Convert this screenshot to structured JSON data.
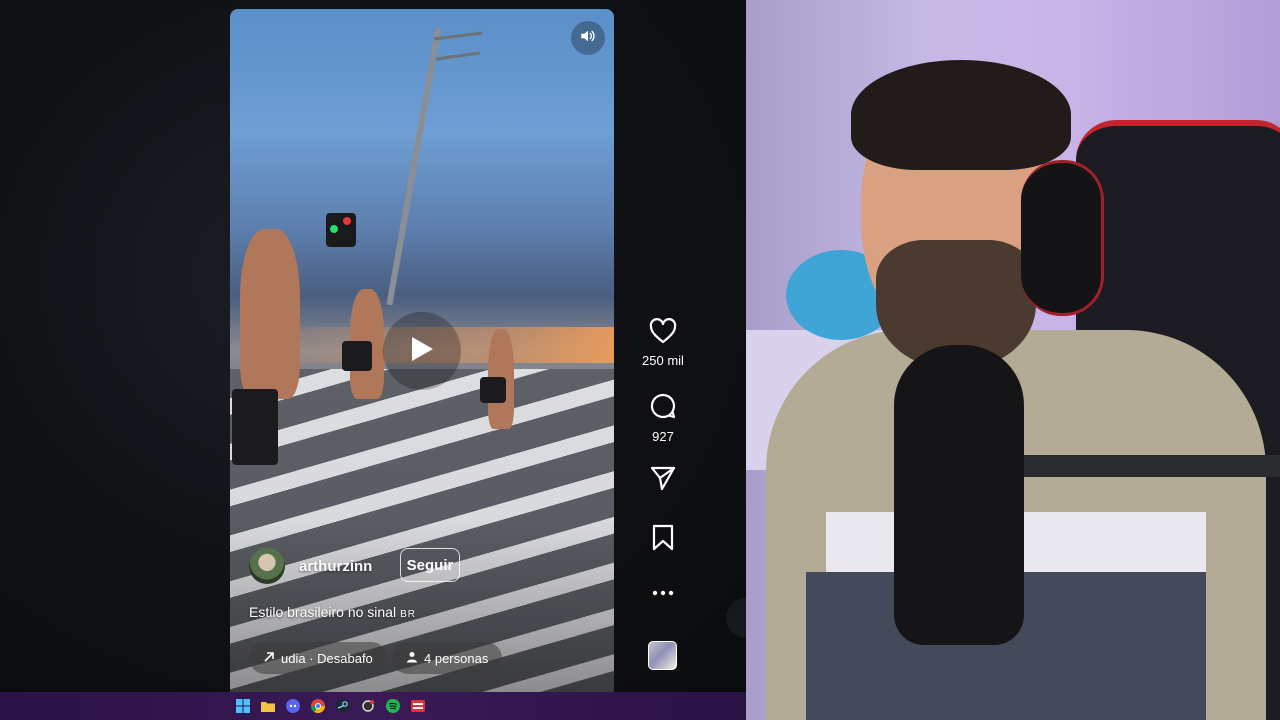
{
  "post": {
    "author": "arthurzinn",
    "follow_label": "Seguir",
    "caption": "Estilo brasileiro no sinal",
    "caption_flag": "BR",
    "audio_chip": "udia · Desabafo",
    "people_chip": "4 personas"
  },
  "actions": {
    "likes": "250 mil",
    "comments": "927"
  },
  "icons": {
    "mute": "speaker-icon",
    "play": "play-icon",
    "like": "heart-icon",
    "comment": "comment-icon",
    "share": "send-icon",
    "save": "bookmark-icon",
    "more": "more-icon",
    "audio": "arrow-up-right-icon",
    "people": "person-icon"
  },
  "taskbar": {
    "apps": [
      "windows-start-icon",
      "file-explorer-icon",
      "discord-icon",
      "chrome-icon",
      "steam-icon",
      "obs-icon",
      "spotify-icon",
      "app-red-icon"
    ]
  },
  "colors": {
    "background": "#0d0f12",
    "taskbar": "#2a1244",
    "webcam_wall": "#c6b9e6"
  }
}
